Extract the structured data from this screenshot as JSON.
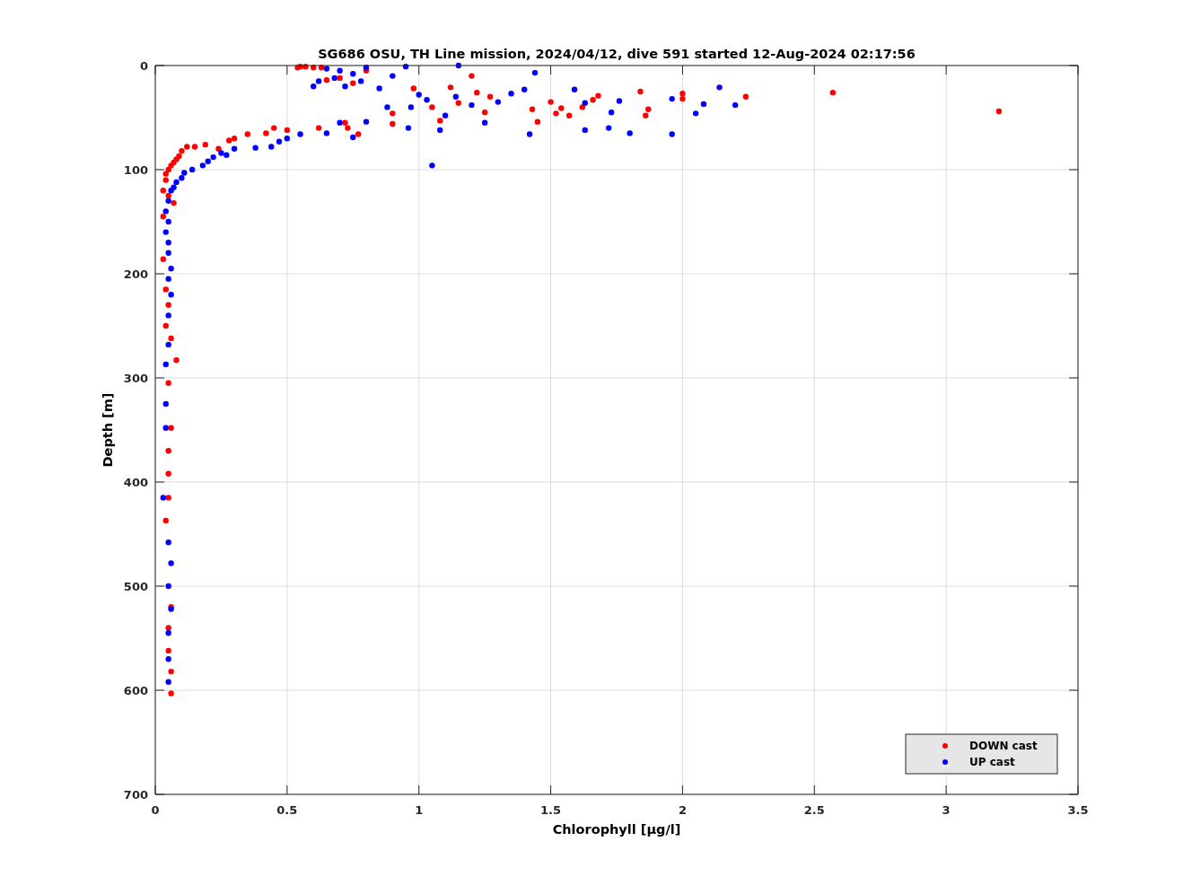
{
  "figure": {
    "chart_data": {
      "type": "scatter",
      "title": "SG686 OSU, TH Line mission, 2024/04/12, dive 591 started 12-Aug-2024 02:17:56",
      "xlabel": "Chlorophyll [μg/l]",
      "ylabel": "Depth [m]",
      "xlim": [
        0,
        3.5
      ],
      "ylim": [
        700,
        0
      ],
      "xticks": [
        0,
        0.5,
        1,
        1.5,
        2,
        2.5,
        3,
        3.5
      ],
      "yticks": [
        0,
        100,
        200,
        300,
        400,
        500,
        600,
        700
      ],
      "grid": true,
      "legend": "lower right",
      "series": [
        {
          "name": "DOWN cast",
          "color": "#ff0000",
          "x": [
            3.2,
            2.57,
            2.24,
            2.0,
            2.0,
            1.84,
            1.87,
            1.86,
            1.68,
            1.66,
            1.62,
            1.57,
            1.54,
            1.52,
            1.5,
            1.45,
            1.43,
            1.27,
            1.22,
            1.25,
            1.2,
            1.15,
            1.12,
            1.08,
            1.05,
            0.98,
            0.9,
            0.9,
            0.8,
            0.75,
            0.72,
            0.7,
            0.65,
            0.6,
            0.57,
            0.55,
            0.54,
            0.63,
            0.73,
            0.77,
            0.62,
            0.5,
            0.45,
            0.42,
            0.35,
            0.3,
            0.28,
            0.24,
            0.19,
            0.15,
            0.12,
            0.1,
            0.09,
            0.08,
            0.07,
            0.06,
            0.05,
            0.04,
            0.04,
            0.03,
            0.05,
            0.07,
            0.03,
            0.03,
            0.04,
            0.05,
            0.04,
            0.06,
            0.08,
            0.05,
            0.06,
            0.05,
            0.05,
            0.05,
            0.04,
            0.06,
            0.05,
            0.05,
            0.06,
            0.06
          ],
          "values": [
            44,
            26,
            30,
            27,
            32,
            25,
            42,
            48,
            29,
            33,
            40,
            48,
            41,
            46,
            35,
            54,
            42,
            30,
            26,
            45,
            10,
            36,
            21,
            53,
            40,
            22,
            46,
            56,
            5,
            17,
            55,
            12,
            14,
            2,
            1,
            1,
            2,
            2,
            60,
            66,
            60,
            62,
            60,
            65,
            66,
            70,
            72,
            80,
            76,
            78,
            78,
            82,
            87,
            90,
            93,
            96,
            100,
            104,
            110,
            120,
            125,
            132,
            145,
            186,
            215,
            230,
            250,
            262,
            283,
            305,
            348,
            370,
            392,
            415,
            437,
            520,
            540,
            562,
            582,
            603
          ]
        },
        {
          "name": "UP cast",
          "color": "#0000ff",
          "x": [
            2.14,
            2.2,
            2.08,
            1.96,
            2.05,
            1.96,
            1.8,
            1.76,
            1.73,
            1.72,
            1.63,
            1.63,
            1.59,
            1.44,
            1.4,
            1.42,
            1.35,
            1.3,
            1.25,
            1.2,
            1.15,
            1.14,
            1.1,
            1.05,
            1.08,
            1.03,
            1.0,
            0.97,
            0.96,
            0.95,
            0.9,
            0.88,
            0.85,
            0.8,
            0.78,
            0.75,
            0.72,
            0.7,
            0.68,
            0.65,
            0.62,
            0.6,
            0.7,
            0.65,
            0.8,
            0.75,
            0.55,
            0.5,
            0.47,
            0.44,
            0.38,
            0.3,
            0.27,
            0.25,
            0.22,
            0.2,
            0.18,
            0.14,
            0.11,
            0.1,
            0.08,
            0.07,
            0.06,
            0.05,
            0.04,
            0.05,
            0.04,
            0.05,
            0.05,
            0.06,
            0.05,
            0.06,
            0.05,
            0.05,
            0.04,
            0.04,
            0.04,
            0.03,
            0.05,
            0.06,
            0.05,
            0.06,
            0.05,
            0.05,
            0.05
          ],
          "values": [
            21,
            38,
            37,
            32,
            46,
            66,
            65,
            34,
            45,
            60,
            36,
            62,
            23,
            7,
            23,
            66,
            27,
            35,
            55,
            38,
            0,
            30,
            48,
            96,
            62,
            33,
            28,
            40,
            60,
            1,
            10,
            40,
            22,
            2,
            15,
            8,
            20,
            5,
            12,
            3,
            15,
            20,
            55,
            65,
            54,
            69,
            66,
            70,
            73,
            78,
            79,
            80,
            86,
            84,
            88,
            92,
            96,
            100,
            103,
            108,
            112,
            117,
            120,
            130,
            140,
            150,
            160,
            170,
            180,
            195,
            205,
            220,
            240,
            268,
            287,
            325,
            348,
            415,
            458,
            478,
            500,
            522,
            545,
            570,
            592
          ]
        }
      ]
    }
  }
}
